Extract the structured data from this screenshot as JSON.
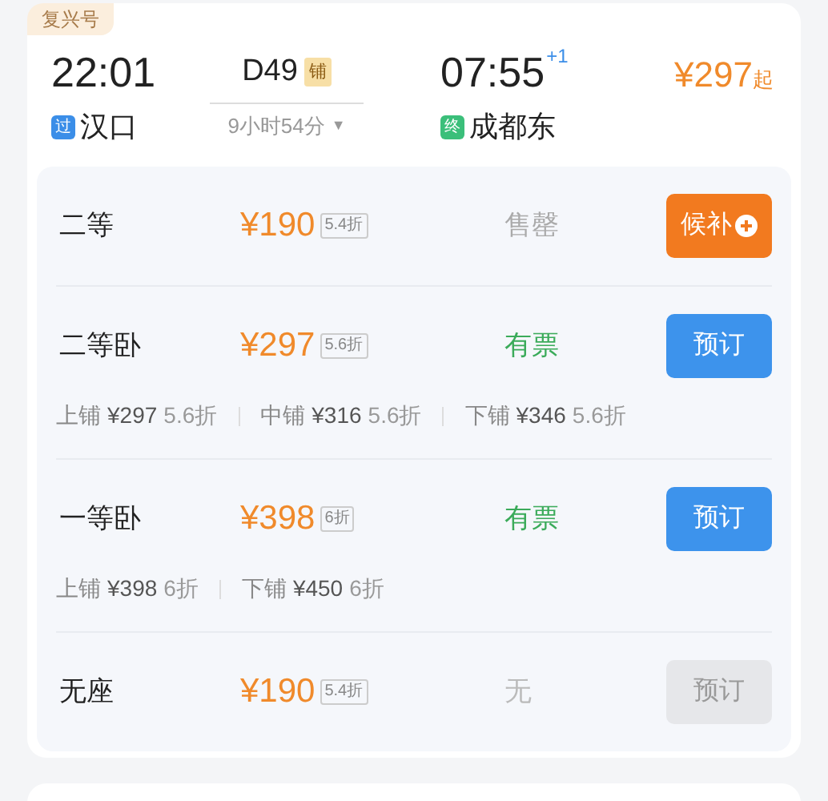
{
  "train_type": "复兴号",
  "departure": {
    "time": "22:01",
    "station": "汉口",
    "badge": "过",
    "color": "#3b8ee8"
  },
  "train": {
    "number": "D49",
    "badge": "铺",
    "duration": "9小时54分",
    "caret": "▼"
  },
  "arrival": {
    "time": "07:55",
    "day_offset": "+1",
    "station": "成都东",
    "badge": "终",
    "color": "#3bbf7a"
  },
  "lowest_price": {
    "amount": "¥297",
    "suffix": "起"
  },
  "seats": [
    {
      "name": "二等",
      "price": "¥190",
      "discount": "5.4折",
      "status": {
        "label": "售罄",
        "kind": "sold_out"
      },
      "button": {
        "label": "候补",
        "kind": "waitlist",
        "disabled": false
      }
    },
    {
      "name": "二等卧",
      "price": "¥297",
      "discount": "5.6折",
      "status": {
        "label": "有票",
        "kind": "available"
      },
      "button": {
        "label": "预订",
        "kind": "book",
        "disabled": false
      },
      "berths": [
        {
          "name": "上铺",
          "price": "¥297",
          "discount": "5.6折"
        },
        {
          "name": "中铺",
          "price": "¥316",
          "discount": "5.6折"
        },
        {
          "name": "下铺",
          "price": "¥346",
          "discount": "5.6折"
        }
      ]
    },
    {
      "name": "一等卧",
      "price": "¥398",
      "discount": "6折",
      "status": {
        "label": "有票",
        "kind": "available"
      },
      "button": {
        "label": "预订",
        "kind": "book",
        "disabled": false
      },
      "berths": [
        {
          "name": "上铺",
          "price": "¥398",
          "discount": "6折"
        },
        {
          "name": "下铺",
          "price": "¥450",
          "discount": "6折"
        }
      ]
    },
    {
      "name": "无座",
      "price": "¥190",
      "discount": "5.4折",
      "status": {
        "label": "无",
        "kind": "none"
      },
      "button": {
        "label": "预订",
        "kind": "book",
        "disabled": true
      }
    }
  ]
}
